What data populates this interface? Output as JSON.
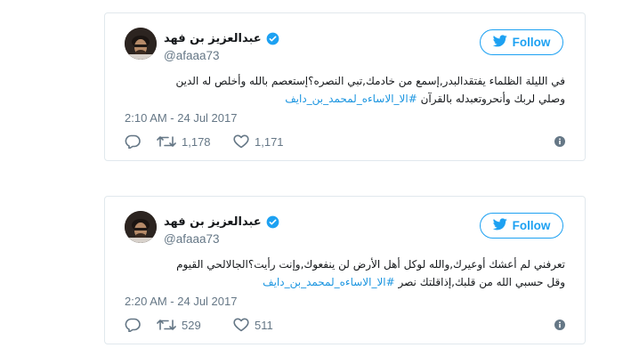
{
  "tweets": [
    {
      "author_name": "عبدالعزيز بن فهد",
      "handle": "@afaaa73",
      "follow_label": "Follow",
      "text_line1": "في الليلة الظلماء يفتقدالبدر,إسمع من خادمك,تبي النصره؟إستعصم بالله وأخلص له الدين",
      "text_line2_plain": "وصلي لربك وأنحروتعبدله بالقرآن ",
      "text_line2_hashtag": "#الا_الاساءه_لمحمد_بن_دايف",
      "timestamp": "2:10 AM - 24 Jul 2017",
      "retweets": "1,178",
      "likes": "1,171"
    },
    {
      "author_name": "عبدالعزيز بن فهد",
      "handle": "@afaaa73",
      "follow_label": "Follow",
      "text_line1": "تعرفني لم أعشك أوعيرك,والله لوكل أهل الأرض لن ينفعوك,وإنت رأيت؟الجالالحي القيوم",
      "text_line2_plain": "وقل حسبي الله من قلبك,إذاقلتك نصر ",
      "text_line2_hashtag": "#الا_الاساءه_لمحمد_بن_دايف",
      "timestamp": "2:20 AM - 24 Jul 2017",
      "retweets": "529",
      "likes": "511"
    }
  ],
  "icons": {
    "verified": "verified-badge-icon",
    "follow_bird": "twitter-bird-icon",
    "reply": "reply-icon",
    "retweet": "retweet-icon",
    "like": "heart-icon",
    "info": "info-icon"
  },
  "colors": {
    "brand": "#1da1f2",
    "hashtag": "#1b95e0",
    "muted": "#657786",
    "text": "#14171a",
    "border": "#e1e8ed"
  }
}
